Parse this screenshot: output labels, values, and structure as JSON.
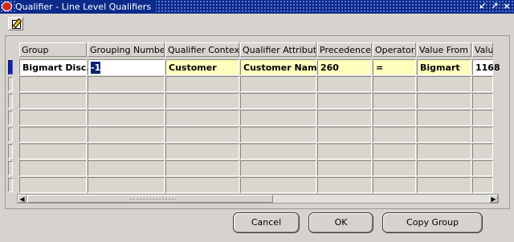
{
  "window": {
    "title": "Qualifier - Line Level Qualifiers"
  },
  "toolbar": {
    "icon": "edit-document-icon"
  },
  "grid": {
    "columns": [
      "Group",
      "Grouping Number",
      "Qualifier Context",
      "Qualifier Attribute",
      "Precedence",
      "Operator",
      "Value From",
      "Value"
    ],
    "first_row": {
      "group": "Bigmart Disc.",
      "grouping_number": "-1",
      "qualifier_context": "Customer",
      "qualifier_attribute": "Customer Name",
      "precedence": "260",
      "operator": "=",
      "value_from": "Bigmart",
      "value_to": "1168"
    },
    "row_count": 8
  },
  "buttons": {
    "cancel": "Cancel",
    "ok": "OK",
    "copy_group": "Copy Group"
  },
  "colors": {
    "title_bar": "#0c2a8a",
    "required_field": "#fefdbc",
    "row_indicator": "#1522a8"
  }
}
